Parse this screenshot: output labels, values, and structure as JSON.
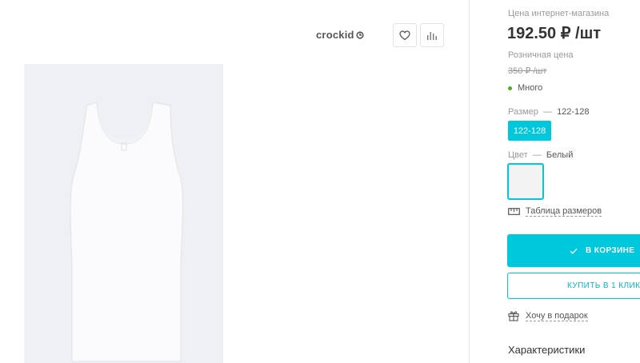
{
  "gallery": {
    "brand": "crockid",
    "favorite_icon": "heart-icon",
    "compare_icon": "bar-chart-icon",
    "photo_icon": "white-tank-top-image"
  },
  "purchase": {
    "online_price_caption": "Цена интернет-магазина",
    "online_price": "192.50 ₽ /шт",
    "retail_price_caption": "Розничная цена",
    "retail_price": "350 ₽ /шт",
    "stock_status": "Много",
    "stock_color": "#4cae1f",
    "size_label": "Размер",
    "dash": "—",
    "size_value": "122-128",
    "size_options": [
      "122-128"
    ],
    "color_label": "Цвет",
    "color_value": "Белый",
    "size_table_link": "Таблица размеров",
    "cart_button": "В КОРЗИНЕ",
    "one_click_button": "КУПИТЬ В 1 КЛИК",
    "gift_link": "Хочу в подарок",
    "specs_heading": "Характеристики",
    "accent_color": "#00c8dc"
  }
}
